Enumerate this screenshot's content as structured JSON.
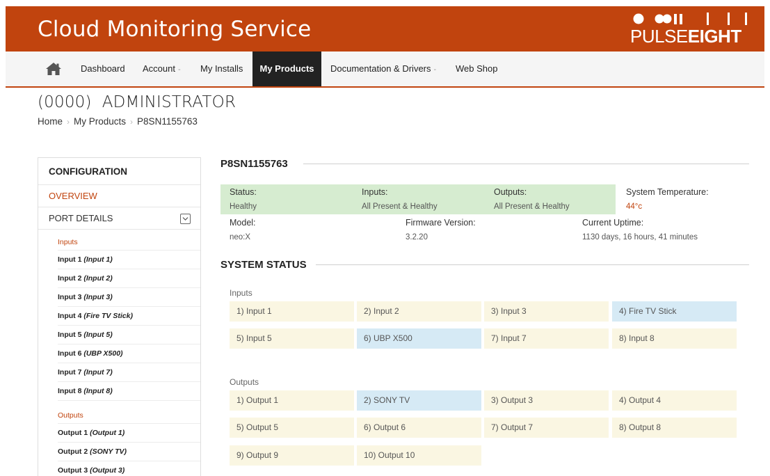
{
  "header": {
    "title": "Cloud Monitoring Service",
    "logo_text_light": "PULSE",
    "logo_text_bold": "EIGHT",
    "brand_color": "#c1440e"
  },
  "nav": {
    "home_icon": "home-icon",
    "items": [
      {
        "label": "Dashboard"
      },
      {
        "label": "Account",
        "caret": "-"
      },
      {
        "label": "My Installs"
      },
      {
        "label": "My Products"
      },
      {
        "label": "Documentation & Drivers",
        "caret": "-"
      },
      {
        "label": "Web Shop"
      }
    ],
    "active": "My Products"
  },
  "account": {
    "name": "(0000)  ADMINISTRATOR"
  },
  "breadcrumb": [
    "Home",
    "My Products",
    "P8SN1155763"
  ],
  "sidebar": {
    "header": "CONFIGURATION",
    "overview": "OVERVIEW",
    "port_details": "PORT DETAILS",
    "inputs_label": "Inputs",
    "inputs": [
      {
        "name": "Input 1",
        "alias": "(Input 1)"
      },
      {
        "name": "Input 2",
        "alias": "(Input 2)"
      },
      {
        "name": "Input 3",
        "alias": "(Input 3)"
      },
      {
        "name": "Input 4",
        "alias": "(Fire TV Stick)"
      },
      {
        "name": "Input 5",
        "alias": "(Input 5)"
      },
      {
        "name": "Input 6",
        "alias": "(UBP X500)"
      },
      {
        "name": "Input 7",
        "alias": "(Input 7)"
      },
      {
        "name": "Input 8",
        "alias": "(Input 8)"
      }
    ],
    "outputs_label": "Outputs",
    "outputs": [
      {
        "name": "Output 1",
        "alias": "(Output 1)"
      },
      {
        "name": "Output 2",
        "alias": "(SONY TV)"
      },
      {
        "name": "Output 3",
        "alias": "(Output 3)"
      }
    ]
  },
  "product": {
    "serial": "P8SN1155763",
    "status_label": "Status:",
    "status_value": "Healthy",
    "inputs_label": "Inputs:",
    "inputs_value": "All Present & Healthy",
    "outputs_label": "Outputs:",
    "outputs_value": "All Present & Healthy",
    "temp_label": "System Temperature:",
    "temp_value": "44°c",
    "model_label": "Model:",
    "model_value": "neo:X",
    "firmware_label": "Firmware Version:",
    "firmware_value": "3.2.20",
    "uptime_label": "Current Uptime:",
    "uptime_value": "1130 days, 16 hours, 41 minutes"
  },
  "system_status": {
    "title": "SYSTEM STATUS",
    "inputs_label": "Inputs",
    "inputs": [
      {
        "label": "1) Input 1",
        "highlight": false
      },
      {
        "label": "2) Input 2",
        "highlight": false
      },
      {
        "label": "3) Input 3",
        "highlight": false
      },
      {
        "label": "4) Fire TV Stick",
        "highlight": true
      },
      {
        "label": "5) Input 5",
        "highlight": false
      },
      {
        "label": "6) UBP X500",
        "highlight": true
      },
      {
        "label": "7) Input 7",
        "highlight": false
      },
      {
        "label": "8) Input 8",
        "highlight": false
      }
    ],
    "outputs_label": "Outputs",
    "outputs": [
      {
        "label": "1) Output 1",
        "highlight": false
      },
      {
        "label": "2) SONY TV",
        "highlight": true
      },
      {
        "label": "3) Output 3",
        "highlight": false
      },
      {
        "label": "4) Output 4",
        "highlight": false
      },
      {
        "label": "5) Output 5",
        "highlight": false
      },
      {
        "label": "6) Output 6",
        "highlight": false
      },
      {
        "label": "7) Output 7",
        "highlight": false
      },
      {
        "label": "8) Output 8",
        "highlight": false
      },
      {
        "label": "9) Output 9",
        "highlight": false
      },
      {
        "label": "10) Output 10",
        "highlight": false
      }
    ],
    "colors": {
      "default_tile": "#faf6e2",
      "highlight_tile": "#d6eaf5",
      "healthy_bg": "#d6ecd0"
    }
  }
}
